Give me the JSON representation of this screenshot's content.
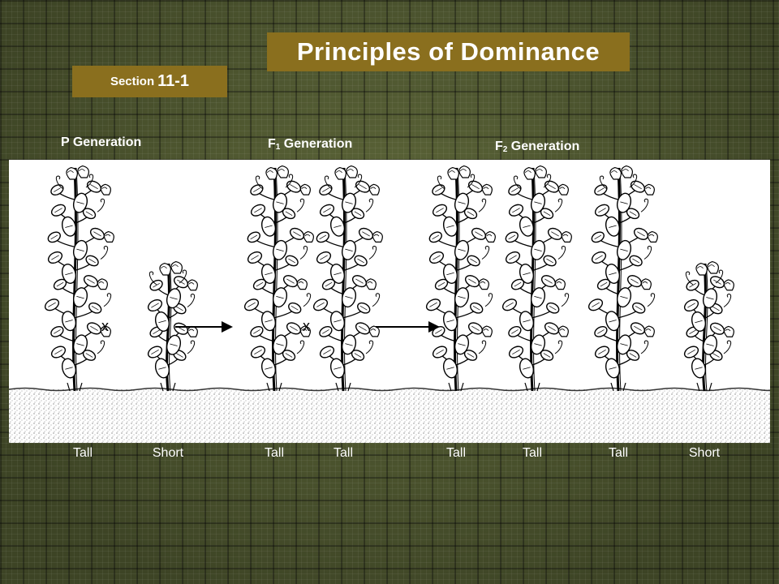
{
  "title": "Principles of Dominance",
  "section": {
    "prefix": "Section",
    "number": "11-1"
  },
  "generations": {
    "p": {
      "label": "P Generation"
    },
    "f1": {
      "prefix": "F",
      "sub": "1",
      "label": " Generation"
    },
    "f2": {
      "prefix": "F",
      "sub": "2",
      "label": " Generation"
    }
  },
  "cross_symbol": "x",
  "plants": [
    {
      "label": "Tall",
      "height": "tall"
    },
    {
      "label": "Short",
      "height": "short"
    },
    {
      "label": "Tall",
      "height": "tall"
    },
    {
      "label": "Tall",
      "height": "tall"
    },
    {
      "label": "Tall",
      "height": "tall"
    },
    {
      "label": "Tall",
      "height": "tall"
    },
    {
      "label": "Tall",
      "height": "tall"
    },
    {
      "label": "Short",
      "height": "short"
    }
  ]
}
